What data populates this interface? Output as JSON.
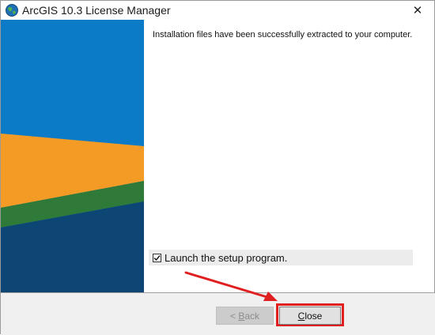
{
  "window": {
    "title": "ArcGIS 10.3 License Manager",
    "close_glyph": "✕"
  },
  "main": {
    "message": "Installation files have been successfully extracted to your computer.",
    "launch_checkbox": {
      "checked": true,
      "label": "Launch the setup program."
    }
  },
  "buttons": {
    "back": {
      "prefix": "< ",
      "accel": "B",
      "rest": "ack",
      "enabled": false
    },
    "close": {
      "accel": "C",
      "rest": "lose"
    }
  },
  "icons": {
    "app": "globe-icon",
    "checkmark": "checkmark-icon",
    "annotation_arrow": "arrow-icon"
  },
  "colors": {
    "banner_blue": "#0b7bc8",
    "banner_orange": "#f49b26",
    "banner_green": "#2f7a39",
    "banner_navy": "#0d4674",
    "annotation_red": "#e02020"
  }
}
